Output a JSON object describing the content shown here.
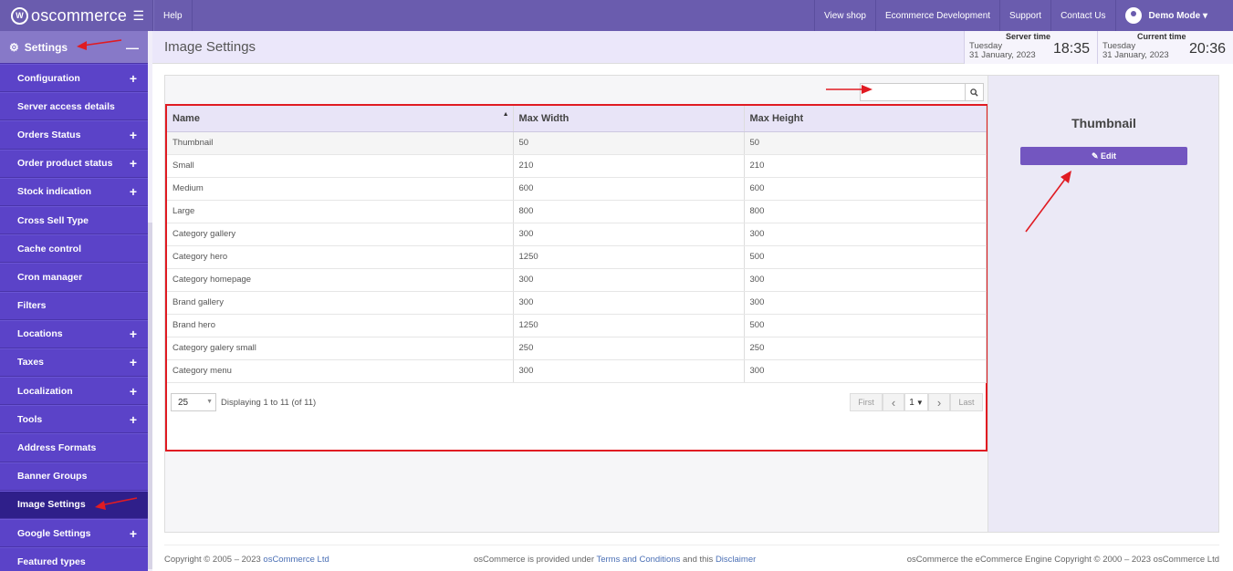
{
  "brand": {
    "name": "oscommerce"
  },
  "topnav": {
    "help": "Help",
    "view_shop": "View shop",
    "ecommerce_dev": "Ecommerce Development",
    "support": "Support",
    "contact_us": "Contact Us",
    "user": "Demo Mode ▾"
  },
  "sidebar": {
    "header": "Settings",
    "items": [
      {
        "label": "Configuration",
        "plus": "+"
      },
      {
        "label": "Server access details",
        "plus": ""
      },
      {
        "label": "Orders Status",
        "plus": "+"
      },
      {
        "label": "Order product status",
        "plus": "+"
      },
      {
        "label": "Stock indication",
        "plus": "+"
      },
      {
        "label": "Cross Sell Type",
        "plus": ""
      },
      {
        "label": "Cache control",
        "plus": ""
      },
      {
        "label": "Cron manager",
        "plus": ""
      },
      {
        "label": "Filters",
        "plus": ""
      },
      {
        "label": "Locations",
        "plus": "+"
      },
      {
        "label": "Taxes",
        "plus": "+"
      },
      {
        "label": "Localization",
        "plus": "+"
      },
      {
        "label": "Tools",
        "plus": "+"
      },
      {
        "label": "Address Formats",
        "plus": ""
      },
      {
        "label": "Banner Groups",
        "plus": ""
      },
      {
        "label": "Image Settings",
        "plus": ""
      },
      {
        "label": "Google Settings",
        "plus": "+"
      },
      {
        "label": "Featured types",
        "plus": ""
      }
    ]
  },
  "header": {
    "title": "Image Settings",
    "server_time": {
      "label": "Server time",
      "day": "Tuesday",
      "date": "31 January, 2023",
      "time": "18:35"
    },
    "current_time": {
      "label": "Current time",
      "day": "Tuesday",
      "date": "31 January, 2023",
      "time": "20:36"
    }
  },
  "table": {
    "columns": [
      "Name",
      "Max Width",
      "Max Height"
    ],
    "rows": [
      [
        "Thumbnail",
        "50",
        "50"
      ],
      [
        "Small",
        "210",
        "210"
      ],
      [
        "Medium",
        "600",
        "600"
      ],
      [
        "Large",
        "800",
        "800"
      ],
      [
        "Category gallery",
        "300",
        "300"
      ],
      [
        "Category hero",
        "1250",
        "500"
      ],
      [
        "Category homepage",
        "300",
        "300"
      ],
      [
        "Brand gallery",
        "300",
        "300"
      ],
      [
        "Brand hero",
        "1250",
        "500"
      ],
      [
        "Category galery small",
        "250",
        "250"
      ],
      [
        "Category menu",
        "300",
        "300"
      ]
    ]
  },
  "pager": {
    "per_page": "25",
    "display": "Displaying 1 to 11 (of 11)",
    "first": "First",
    "prev": "‹",
    "page": "1",
    "next": "›",
    "last": "Last"
  },
  "detail": {
    "title": "Thumbnail",
    "edit_label": "✎ Edit"
  },
  "footer": {
    "copy_prefix": "Copyright © 2005 – 2023 ",
    "copy_link": "osCommerce Ltd",
    "mid_prefix": "osCommerce is provided under ",
    "terms": "Terms and Conditions",
    "mid_middle": " and this ",
    "disclaimer": "Disclaimer",
    "right": "osCommerce the eCommerce Engine Copyright © 2000 – 2023 osCommerce Ltd"
  },
  "colors": {
    "topbar": "#6a5cae",
    "sidebar": "#5b43c8",
    "highlight_border": "#e01b22",
    "button": "#7356c0"
  }
}
